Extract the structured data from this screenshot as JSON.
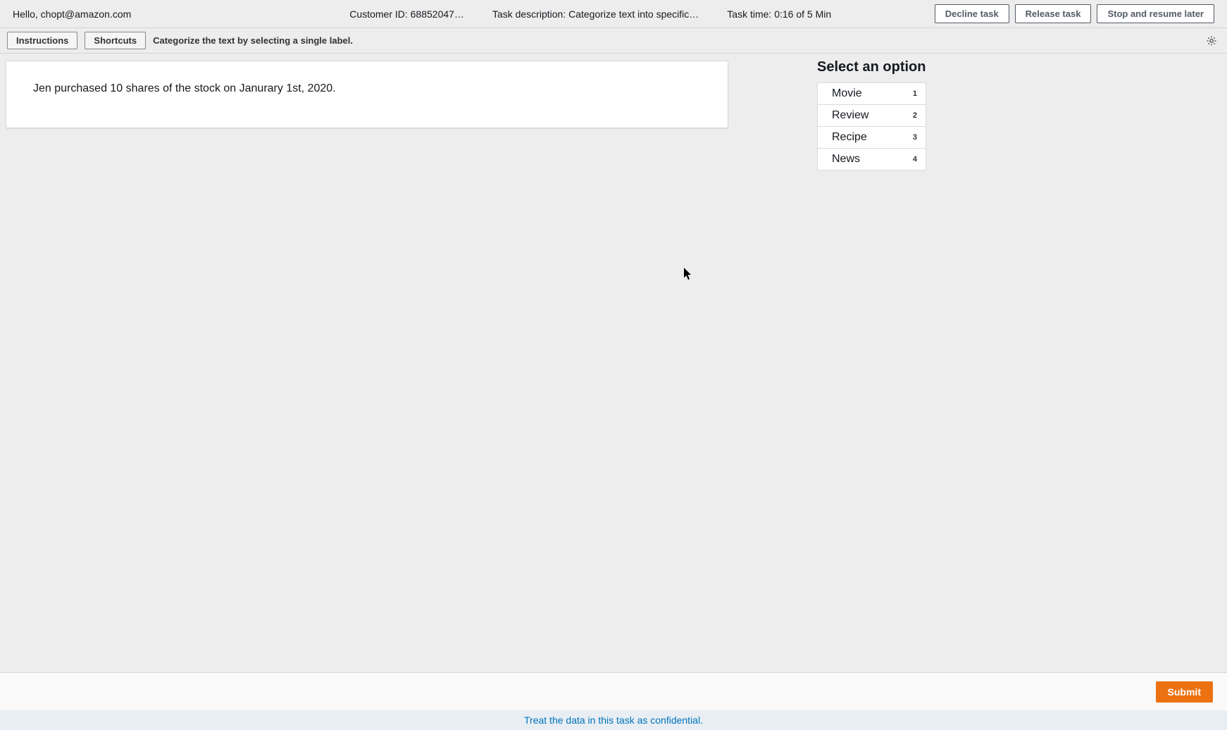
{
  "header": {
    "greeting": "Hello, chopt@amazon.com",
    "customer_id": "Customer ID: 68852047…",
    "task_desc": "Task description: Categorize text into specific…",
    "task_time": "Task time: 0:16 of 5 Min",
    "decline_label": "Decline task",
    "release_label": "Release task",
    "stop_label": "Stop and resume later"
  },
  "subbar": {
    "instructions_label": "Instructions",
    "shortcuts_label": "Shortcuts",
    "hint": "Categorize the text by selecting a single label."
  },
  "card": {
    "text": "Jen purchased 10 shares of the stock on Janurary 1st, 2020."
  },
  "options": {
    "title": "Select an option",
    "items": [
      {
        "label": "Movie",
        "shortcut": "1"
      },
      {
        "label": "Review",
        "shortcut": "2"
      },
      {
        "label": "Recipe",
        "shortcut": "3"
      },
      {
        "label": "News",
        "shortcut": "4"
      }
    ]
  },
  "footer": {
    "submit_label": "Submit"
  },
  "confidential": "Treat the data in this task as confidential."
}
